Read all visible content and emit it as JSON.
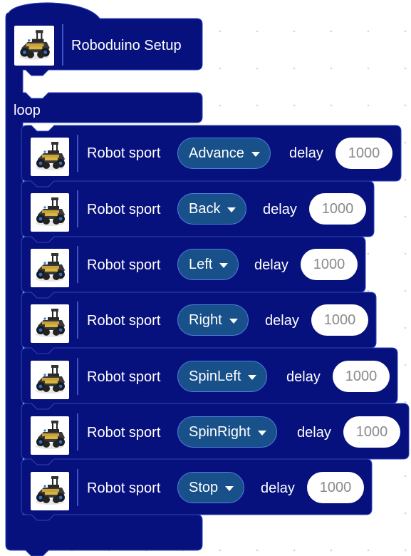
{
  "colors": {
    "block_fill": "#06117e",
    "block_stroke": "#2d43b9",
    "dropdown_fill": "#18508a",
    "workspace_bg": "#ffffff"
  },
  "setup": {
    "label": "Roboduino Setup",
    "icon": "robot-car-icon"
  },
  "loop": {
    "label": "loop"
  },
  "blocks": [
    {
      "label": "Robot sport",
      "direction": "Advance",
      "delay_label": "delay",
      "delay_value": "1000",
      "icon": "robot-car-icon"
    },
    {
      "label": "Robot sport",
      "direction": "Back",
      "delay_label": "delay",
      "delay_value": "1000",
      "icon": "robot-car-icon"
    },
    {
      "label": "Robot sport",
      "direction": "Left",
      "delay_label": "delay",
      "delay_value": "1000",
      "icon": "robot-car-icon"
    },
    {
      "label": "Robot sport",
      "direction": "Right",
      "delay_label": "delay",
      "delay_value": "1000",
      "icon": "robot-car-icon"
    },
    {
      "label": "Robot sport",
      "direction": "SpinLeft",
      "delay_label": "delay",
      "delay_value": "1000",
      "icon": "robot-car-icon"
    },
    {
      "label": "Robot sport",
      "direction": "SpinRight",
      "delay_label": "delay",
      "delay_value": "1000",
      "icon": "robot-car-icon"
    },
    {
      "label": "Robot sport",
      "direction": "Stop",
      "delay_label": "delay",
      "delay_value": "1000",
      "icon": "robot-car-icon"
    }
  ]
}
